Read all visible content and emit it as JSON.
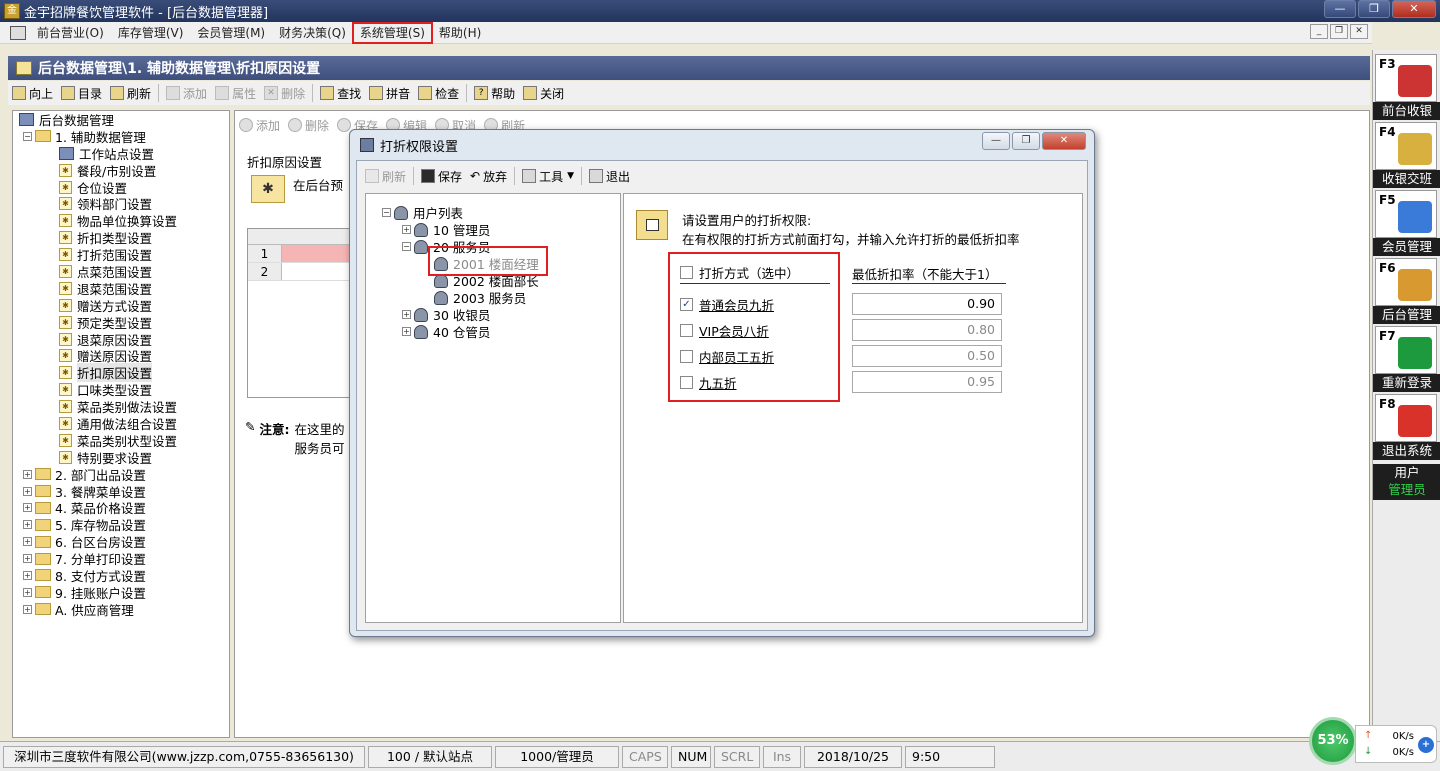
{
  "window": {
    "title": "金宇招牌餐饮管理软件 - [后台数据管理器]"
  },
  "menu": [
    {
      "label": "前台营业(O)"
    },
    {
      "label": "库存管理(V)"
    },
    {
      "label": "会员管理(M)"
    },
    {
      "label": "财务决策(Q)"
    },
    {
      "label": "系统管理(S)"
    },
    {
      "label": "帮助(H)"
    }
  ],
  "breadcrumb": "后台数据管理\\1. 辅助数据管理\\折扣原因设置",
  "toolbar": {
    "up": "向上",
    "catalog": "目录",
    "refresh": "刷新",
    "add": "添加",
    "props": "属性",
    "delete": "删除",
    "find": "查找",
    "pinyin": "拼音",
    "check": "检查",
    "help": "帮助",
    "close": "关闭"
  },
  "tree": {
    "root": "后台数据管理",
    "group1": "1. 辅助数据管理",
    "children": [
      "工作站点设置",
      "餐段/市别设置",
      "仓位设置",
      "领料部门设置",
      "物品单位换算设置",
      "折扣类型设置",
      "打折范围设置",
      "点菜范围设置",
      "退菜范围设置",
      "赠送方式设置",
      "预定类型设置",
      "退菜原因设置",
      "赠送原因设置",
      "折扣原因设置",
      "口味类型设置",
      "菜品类别做法设置",
      "通用做法组合设置",
      "菜品类别状型设置",
      "特别要求设置"
    ],
    "groups": [
      "2. 部门出品设置",
      "3. 餐牌菜单设置",
      "4. 菜品价格设置",
      "5. 库存物品设置",
      "6. 台区台房设置",
      "7. 分单打印设置",
      "8. 支付方式设置",
      "9. 挂账账户设置",
      "A. 供应商管理"
    ]
  },
  "content": {
    "toolbar": {
      "add": "添加",
      "delete": "删除",
      "save": "保存",
      "edit": "编辑",
      "cancel": "取消",
      "refresh": "刷新"
    },
    "title": "折扣原因设置",
    "desc": "在后台预",
    "rows": [
      "1",
      "2"
    ],
    "note_label": "注意:",
    "note_line1": "在这里的",
    "note_line2": "服务员可"
  },
  "dialog": {
    "title": "打折权限设置",
    "toolbar": {
      "refresh": "刷新",
      "save": "保存",
      "discard": "放弃",
      "tools": "工具",
      "exit": "退出"
    },
    "user_tree": {
      "root": "用户列表",
      "items": [
        {
          "label": "10 管理员"
        },
        {
          "label": "20 服务员"
        },
        {
          "label": "2001 楼面经理"
        },
        {
          "label": "2002 楼面部长"
        },
        {
          "label": "2003 服务员"
        },
        {
          "label": "30 收银员"
        },
        {
          "label": "40 仓管员"
        }
      ]
    },
    "instr1": "请设置用户的打折权限:",
    "instr2": "在有权限的打折方式前面打勾，并输入允许打折的最低折扣率",
    "option_header": "打折方式（选中）",
    "rate_header": "最低折扣率（不能大于1）",
    "options": [
      {
        "label": "普通会员九折",
        "checked": true,
        "rate": "0.90"
      },
      {
        "label": "VIP会员八折",
        "checked": false,
        "rate": "0.80"
      },
      {
        "label": "内部员工五折",
        "checked": false,
        "rate": "0.50"
      },
      {
        "label": "九五折",
        "checked": false,
        "rate": "0.95"
      }
    ]
  },
  "sidebar": {
    "keys": [
      {
        "key": "F3",
        "label": "前台收银"
      },
      {
        "key": "F4",
        "label": "收银交班"
      },
      {
        "key": "F5",
        "label": "会员管理"
      },
      {
        "key": "F6",
        "label": "后台管理"
      },
      {
        "key": "F7",
        "label": "重新登录"
      },
      {
        "key": "F8",
        "label": "退出系统"
      }
    ],
    "user_label": "用户",
    "user_name": "管理员"
  },
  "status": {
    "company": "深圳市三度软件有限公司(www.jzzp.com,0755-83656130)",
    "station": "100 / 默认站点",
    "user": "1000/管理员",
    "caps": "CAPS",
    "num": "NUM",
    "scrl": "SCRL",
    "ins": "Ins",
    "date": "2018/10/25",
    "time": "9:50"
  },
  "net": {
    "percent": "53%",
    "up": "0K/s",
    "down": "0K/s"
  }
}
